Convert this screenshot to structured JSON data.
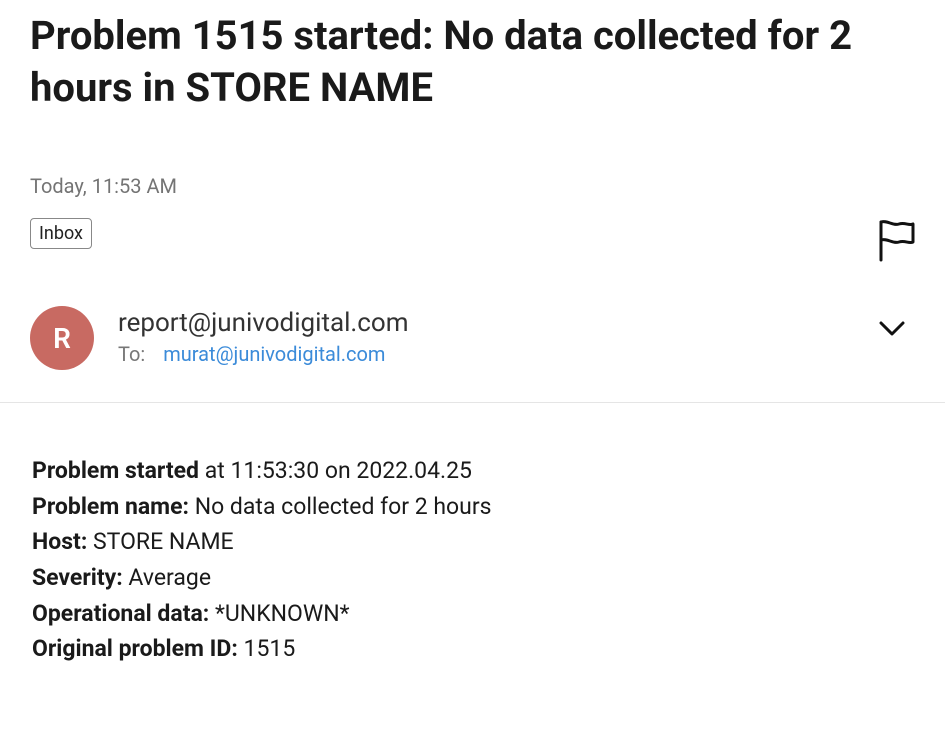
{
  "subject": "Problem 1515 started: No data collected for 2 hours in STORE NAME",
  "timestamp": "Today, 11:53 AM",
  "folder_chip": "Inbox",
  "avatar_initial": "R",
  "sender_email": "report@junivodigital.com",
  "to_label": "To:",
  "recipient_email": "murat@junivodigital.com",
  "body": {
    "problem_started_label": "Problem started",
    "problem_started_value": " at 11:53:30 on 2022.04.25",
    "problem_name_label": "Problem name:",
    "problem_name_value": " No data collected for 2 hours",
    "host_label": "Host:",
    "host_value": " STORE NAME",
    "severity_label": "Severity:",
    "severity_value": " Average",
    "operational_data_label": "Operational data:",
    "operational_data_value": " *UNKNOWN*",
    "original_problem_id_label": "Original problem ID:",
    "original_problem_id_value": " 1515"
  }
}
